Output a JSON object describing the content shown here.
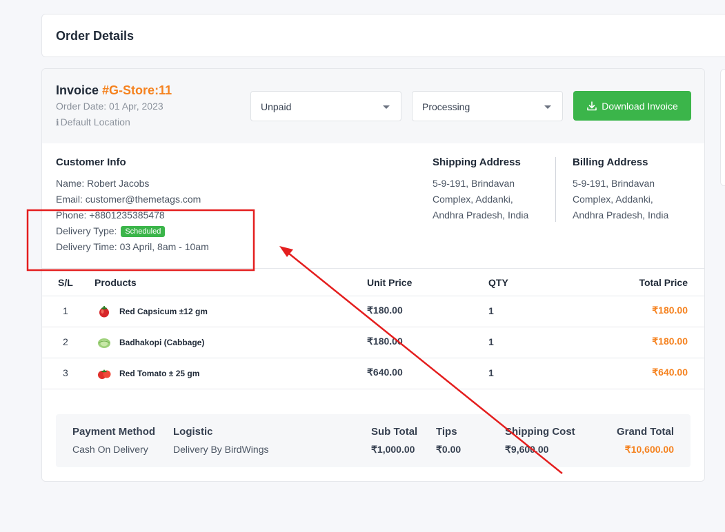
{
  "page_title": "Order Details",
  "invoice": {
    "label": "Invoice",
    "number": "#G-Store:11",
    "order_date": "Order Date: 01 Apr, 2023",
    "location": "Default Location",
    "payment_status": "Unpaid",
    "delivery_status": "Processing",
    "download_label": "Download Invoice"
  },
  "customer": {
    "title": "Customer Info",
    "name": "Name: Robert Jacobs",
    "email": "Email: customer@themetags.com",
    "phone": "Phone: +8801235385478",
    "delivery_type_label": "Delivery Type:",
    "delivery_type_badge": "Scheduled",
    "delivery_time": "Delivery Time: 03 April, 8am - 10am"
  },
  "shipping": {
    "title": "Shipping Address",
    "lines": [
      "5-9-191, Brindavan",
      "Complex, Addanki,",
      "Andhra Pradesh, India"
    ]
  },
  "billing": {
    "title": "Billing Address",
    "lines": [
      "5-9-191, Brindavan",
      "Complex, Addanki,",
      "Andhra Pradesh, India"
    ]
  },
  "table": {
    "headers": [
      "S/L",
      "Products",
      "Unit Price",
      "QTY",
      "Total Price"
    ],
    "rows": [
      {
        "sl": "1",
        "product": "Red Capsicum ±12 gm",
        "unit_price": "₹180.00",
        "qty": "1",
        "total": "₹180.00",
        "icon": "capsicum-icon"
      },
      {
        "sl": "2",
        "product": "Badhakopi (Cabbage)",
        "unit_price": "₹180.00",
        "qty": "1",
        "total": "₹180.00",
        "icon": "cabbage-icon"
      },
      {
        "sl": "3",
        "product": "Red Tomato ± 25 gm",
        "unit_price": "₹640.00",
        "qty": "1",
        "total": "₹640.00",
        "icon": "tomato-icon"
      }
    ]
  },
  "summary": {
    "payment_method_label": "Payment Method",
    "payment_method": "Cash On Delivery",
    "logistic_label": "Logistic",
    "logistic": "Delivery By BirdWings",
    "sub_total_label": "Sub Total",
    "sub_total": "₹1,000.00",
    "tips_label": "Tips",
    "tips": "₹0.00",
    "shipping_cost_label": "Shipping Cost",
    "shipping_cost": "₹9,600.00",
    "grand_total_label": "Grand Total",
    "grand_total": "₹10,600.00"
  },
  "colors": {
    "accent_orange": "#f5821f",
    "success_green": "#3bb54a",
    "annotation_red": "#e41e1e"
  }
}
